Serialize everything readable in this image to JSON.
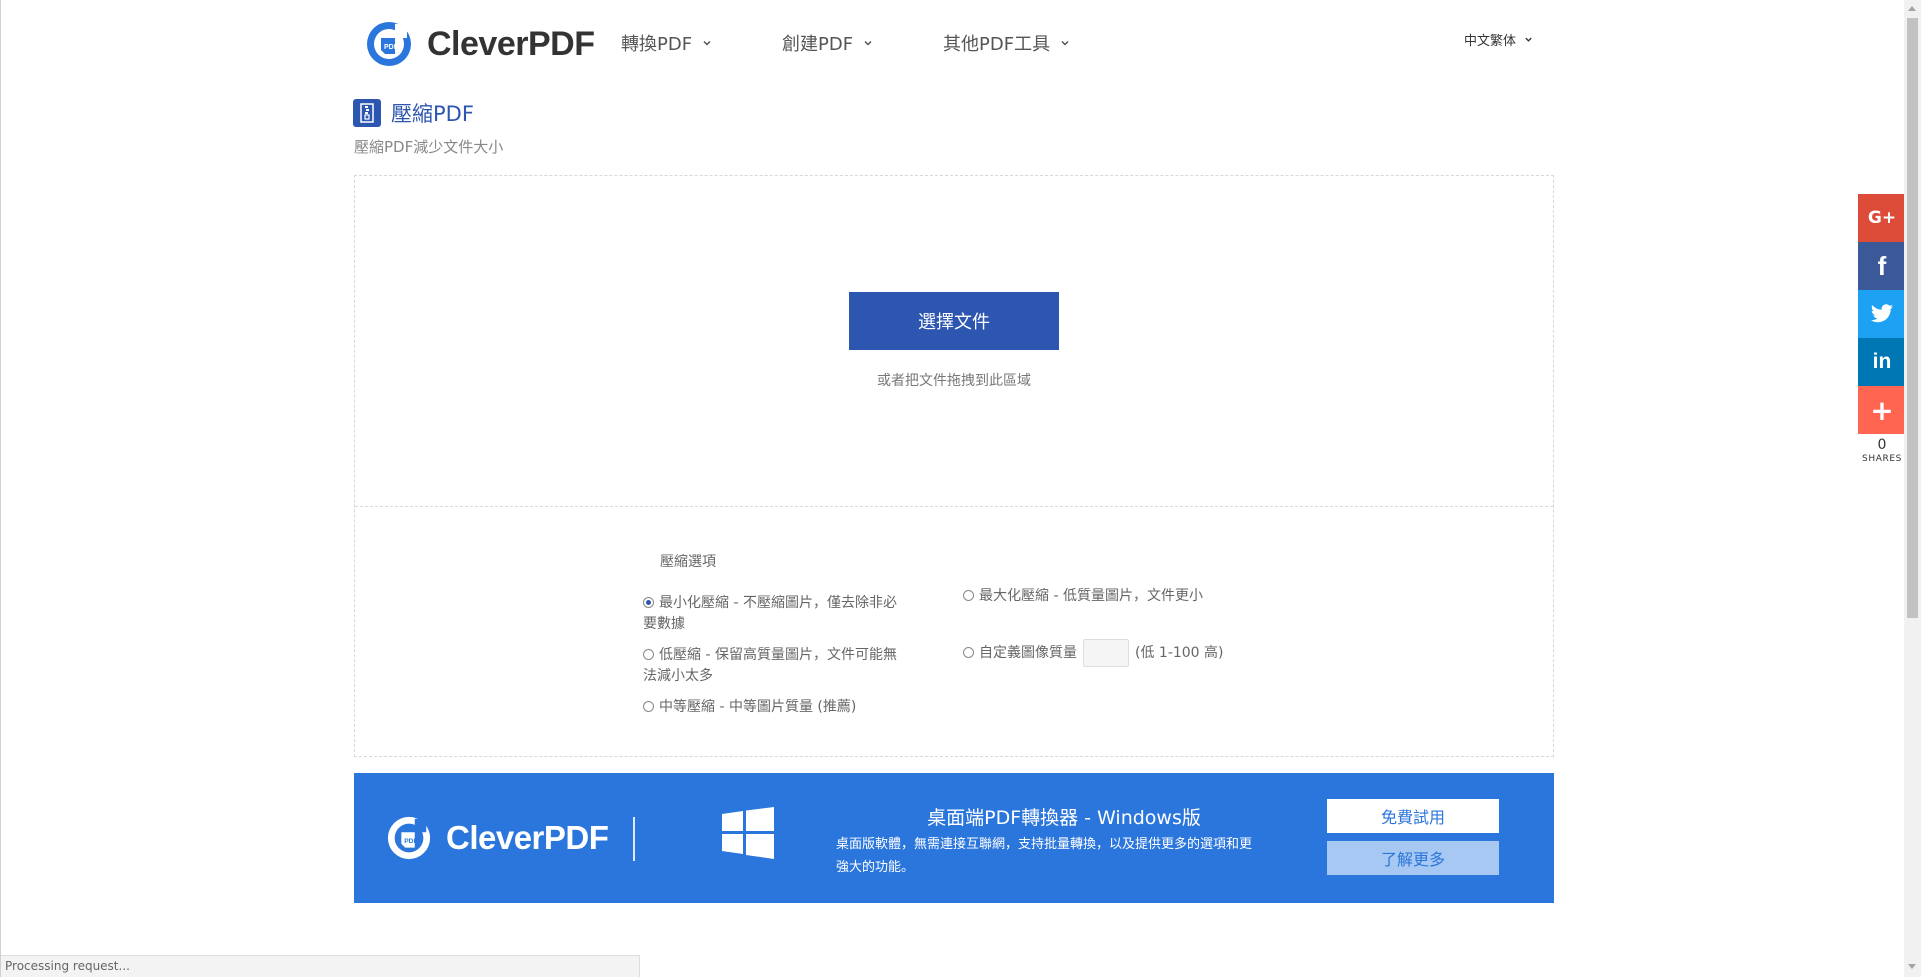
{
  "header": {
    "brand": "CleverPDF",
    "nav": [
      {
        "label": "轉換PDF"
      },
      {
        "label": "創建PDF"
      },
      {
        "label": "其他PDF工具"
      }
    ],
    "language": "中文繁体"
  },
  "tool": {
    "title": "壓縮PDF",
    "subtitle": "壓縮PDF減少文件大小"
  },
  "upload": {
    "choose_label": "選擇文件",
    "drop_hint": "或者把文件拖拽到此區域"
  },
  "options": {
    "label": "壓縮選項",
    "items": [
      {
        "label": "最小化壓縮 - 不壓縮圖片，僅去除非必要數據",
        "selected": true
      },
      {
        "label": "低壓縮 - 保留高質量圖片，文件可能無法減小太多",
        "selected": false
      },
      {
        "label": "中等壓縮 - 中等圖片質量 (推薦)",
        "selected": false
      },
      {
        "label": "最大化壓縮 - 低質量圖片，文件更小",
        "selected": false
      },
      {
        "label": "自定義圖像質量",
        "selected": false
      }
    ],
    "custom_hint": "(低 1-100 高)",
    "custom_value": ""
  },
  "banner": {
    "brand": "CleverPDF",
    "title": "桌面端PDF轉換器 - Windows版",
    "description": "桌面版軟體，無需連接互聯網，支持批量轉換，以及提供更多的選項和更強大的功能。",
    "trial_label": "免費試用",
    "more_label": "了解更多"
  },
  "share": {
    "buttons": [
      {
        "name": "google-plus",
        "label": "G+",
        "color": "#dd4b39"
      },
      {
        "name": "facebook",
        "label": "f",
        "color": "#3b5998"
      },
      {
        "name": "twitter",
        "color": "#1da1f2"
      },
      {
        "name": "linkedin",
        "label": "in",
        "color": "#0077b5"
      },
      {
        "name": "more",
        "label": "+",
        "color": "#ff6550"
      }
    ],
    "count": "0",
    "label": "SHARES"
  },
  "status": "Processing request...",
  "colors": {
    "primary": "#2d56b0",
    "banner": "#2b76dc"
  }
}
